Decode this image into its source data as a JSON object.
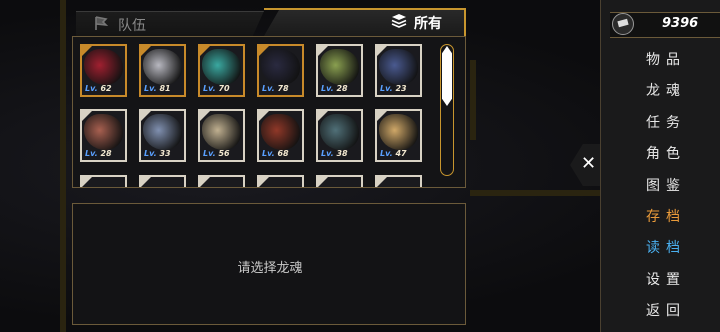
{
  "tabs": {
    "team_label": "队伍",
    "all_label": "所有"
  },
  "souls": [
    {
      "level_prefix": "Lv.",
      "level": "62",
      "color": "#a02030",
      "frame": "gold"
    },
    {
      "level_prefix": "Lv.",
      "level": "81",
      "color": "#b8b8c0",
      "frame": "gold"
    },
    {
      "level_prefix": "Lv.",
      "level": "70",
      "color": "#3aa8a0",
      "frame": "gold"
    },
    {
      "level_prefix": "Lv.",
      "level": "78",
      "color": "#2a2a40",
      "frame": "gold"
    },
    {
      "level_prefix": "Lv.",
      "level": "28",
      "color": "#8aa050",
      "frame": "plain"
    },
    {
      "level_prefix": "Lv.",
      "level": "23",
      "color": "#4a5a90",
      "frame": "plain"
    },
    {
      "level_prefix": "Lv.",
      "level": "28",
      "color": "#a86050",
      "frame": "plain"
    },
    {
      "level_prefix": "Lv.",
      "level": "33",
      "color": "#8090b0",
      "frame": "plain"
    },
    {
      "level_prefix": "Lv.",
      "level": "56",
      "color": "#c0b090",
      "frame": "plain"
    },
    {
      "level_prefix": "Lv.",
      "level": "68",
      "color": "#903828",
      "frame": "plain"
    },
    {
      "level_prefix": "Lv.",
      "level": "38",
      "color": "#507078",
      "frame": "plain"
    },
    {
      "level_prefix": "Lv.",
      "level": "47",
      "color": "#d0a868",
      "frame": "plain"
    }
  ],
  "detail": {
    "placeholder": "请选择龙魂"
  },
  "currency": {
    "value": "9396",
    "icon": "coin-icon"
  },
  "menu": [
    {
      "label": "物品",
      "color": "#e8e8e8"
    },
    {
      "label": "龙魂",
      "color": "#e8e8e8"
    },
    {
      "label": "任务",
      "color": "#e8e8e8"
    },
    {
      "label": "角色",
      "color": "#e8e8e8"
    },
    {
      "label": "图鉴",
      "color": "#e8e8e8"
    },
    {
      "label": "存档",
      "color": "#e89a3a"
    },
    {
      "label": "读档",
      "color": "#4ab0f0"
    },
    {
      "label": "设置",
      "color": "#e8e8e8"
    },
    {
      "label": "返回",
      "color": "#e8e8e8"
    }
  ],
  "close_icon": "close-icon"
}
